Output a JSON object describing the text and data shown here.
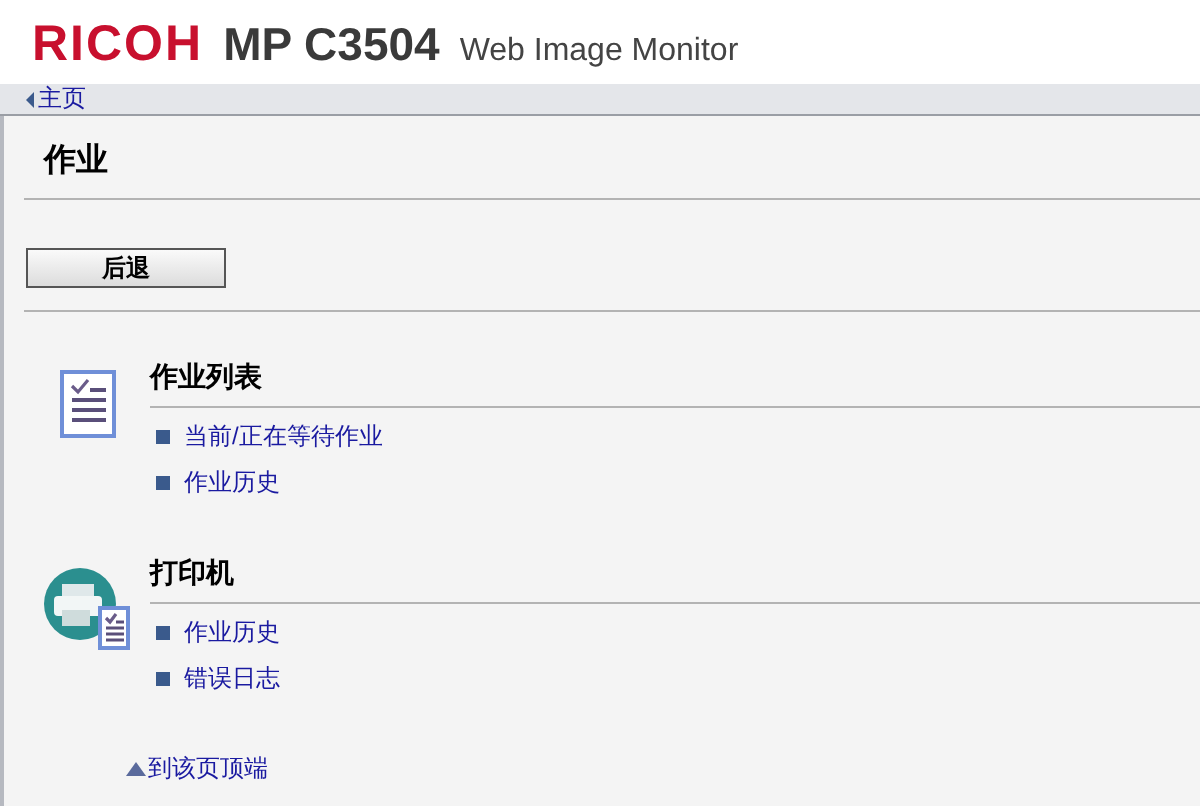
{
  "header": {
    "brand": "RICOH",
    "model": "MP C3504",
    "product": "Web Image Monitor"
  },
  "breadcrumb": {
    "label": "主页"
  },
  "page": {
    "title": "作业",
    "back_button": "后退"
  },
  "sections": [
    {
      "title": "作业列表",
      "kind": "list",
      "links": [
        "当前/正在等待作业",
        "作业历史"
      ]
    },
    {
      "title": "打印机",
      "kind": "printer",
      "links": [
        "作业历史",
        "错误日志"
      ]
    }
  ],
  "top_link": "到该页顶端"
}
